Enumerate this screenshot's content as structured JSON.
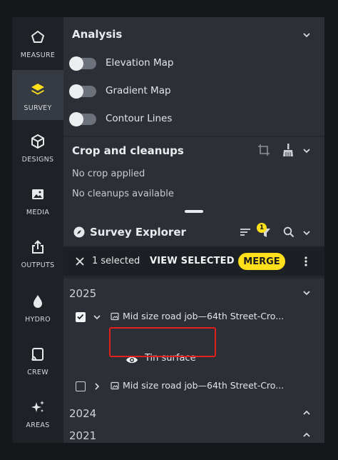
{
  "sidebar": {
    "items": [
      {
        "label": "MEASURE",
        "icon": "pentagon-icon",
        "active": false
      },
      {
        "label": "SURVEY",
        "icon": "layers-icon",
        "active": true
      },
      {
        "label": "DESIGNS",
        "icon": "cube-icon",
        "active": false
      },
      {
        "label": "MEDIA",
        "icon": "image-icon",
        "active": false
      },
      {
        "label": "OUTPUTS",
        "icon": "share-icon",
        "active": false
      },
      {
        "label": "HYDRO",
        "icon": "water-drop-icon",
        "active": false
      },
      {
        "label": "CREW",
        "icon": "cast-icon",
        "active": false
      },
      {
        "label": "AREAS",
        "icon": "sparkle-icon",
        "active": false
      }
    ]
  },
  "analysis": {
    "title": "Analysis",
    "toggles": [
      {
        "label": "Elevation Map",
        "on": false
      },
      {
        "label": "Gradient Map",
        "on": false
      },
      {
        "label": "Contour Lines",
        "on": false
      }
    ]
  },
  "crop": {
    "title": "Crop and cleanups",
    "crop_status": "No crop applied",
    "cleanup_status": "No cleanups available"
  },
  "explorer": {
    "title": "Survey Explorer",
    "filter_badge": "1",
    "selected_text": "1 selected",
    "view_selected": "VIEW SELECTED",
    "merge": "MERGE",
    "years": [
      {
        "label": "2025",
        "expanded": true
      },
      {
        "label": "2024",
        "expanded": false
      },
      {
        "label": "2021",
        "expanded": false
      }
    ],
    "rows": [
      {
        "label": "Mid size road job—64th Street-Cro...",
        "checked": true
      },
      {
        "label": "Tin surface"
      },
      {
        "label": "Mid size road job—64th Street-Cro...",
        "checked": false
      }
    ]
  },
  "colors": {
    "accent": "#ffe01b",
    "highlight": "#e2211c",
    "panel": "#2c2f35"
  }
}
